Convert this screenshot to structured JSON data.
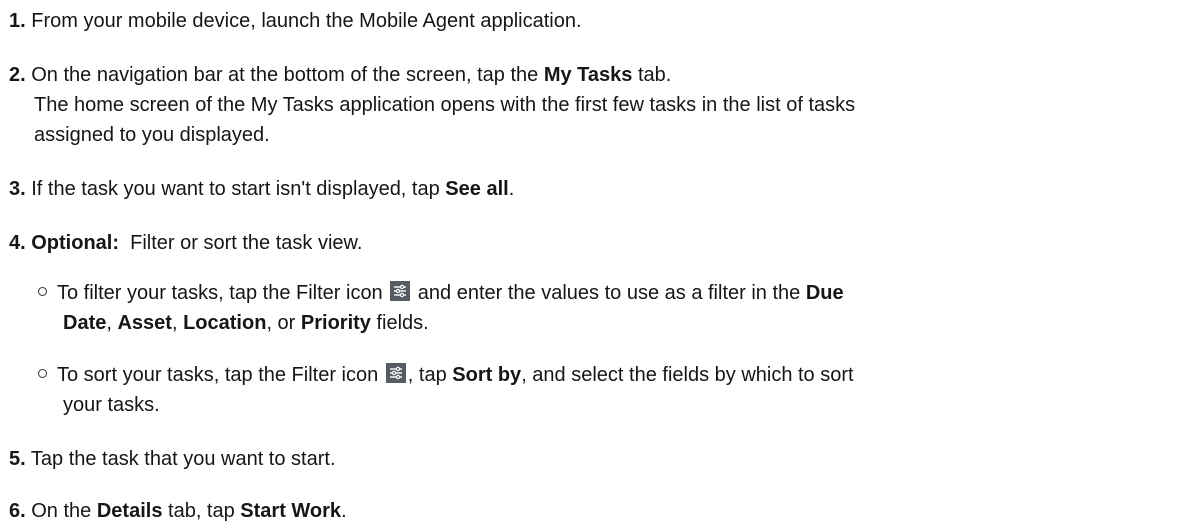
{
  "steps": [
    {
      "num": "1.",
      "text": "From your mobile device, launch the Mobile Agent application."
    },
    {
      "num": "2.",
      "t1": "On the navigation bar at the bottom of the screen, tap the ",
      "b1": "My Tasks",
      "t2": " tab.",
      "line2": "The home screen of the My Tasks application opens with the first few tasks in the list of tasks",
      "line3": "assigned to you displayed."
    },
    {
      "num": "3.",
      "t1": "If the task you want to start isn't displayed, tap ",
      "b1": "See all",
      "t2": "."
    },
    {
      "num": "4.",
      "b1": "Optional:",
      "t1": "  Filter or sort the task view.",
      "subs": [
        {
          "t1": "To filter your tasks, tap the Filter icon ",
          "t2": " and enter the values to use as a filter in the ",
          "b1": "Due",
          "b2": "Date",
          "t3": ", ",
          "b3": "Asset",
          "t4": ", ",
          "b4": "Location",
          "t5": ", or ",
          "b5": "Priority",
          "t6": " fields."
        },
        {
          "t1": "To sort your tasks, tap the Filter icon ",
          "t2": ", tap ",
          "b1": "Sort by",
          "t3": ", and select the fields by which to sort",
          "line2": "your tasks."
        }
      ]
    },
    {
      "num": "5.",
      "text": "Tap the task that you want to start."
    },
    {
      "num": "6.",
      "t1": "On the ",
      "b1": "Details",
      "t2": " tab, tap ",
      "b2": "Start Work",
      "t3": "."
    }
  ],
  "icons": {
    "filter": "filter-icon"
  },
  "colors": {
    "text": "#161616",
    "icon_bg": "#565b64"
  }
}
